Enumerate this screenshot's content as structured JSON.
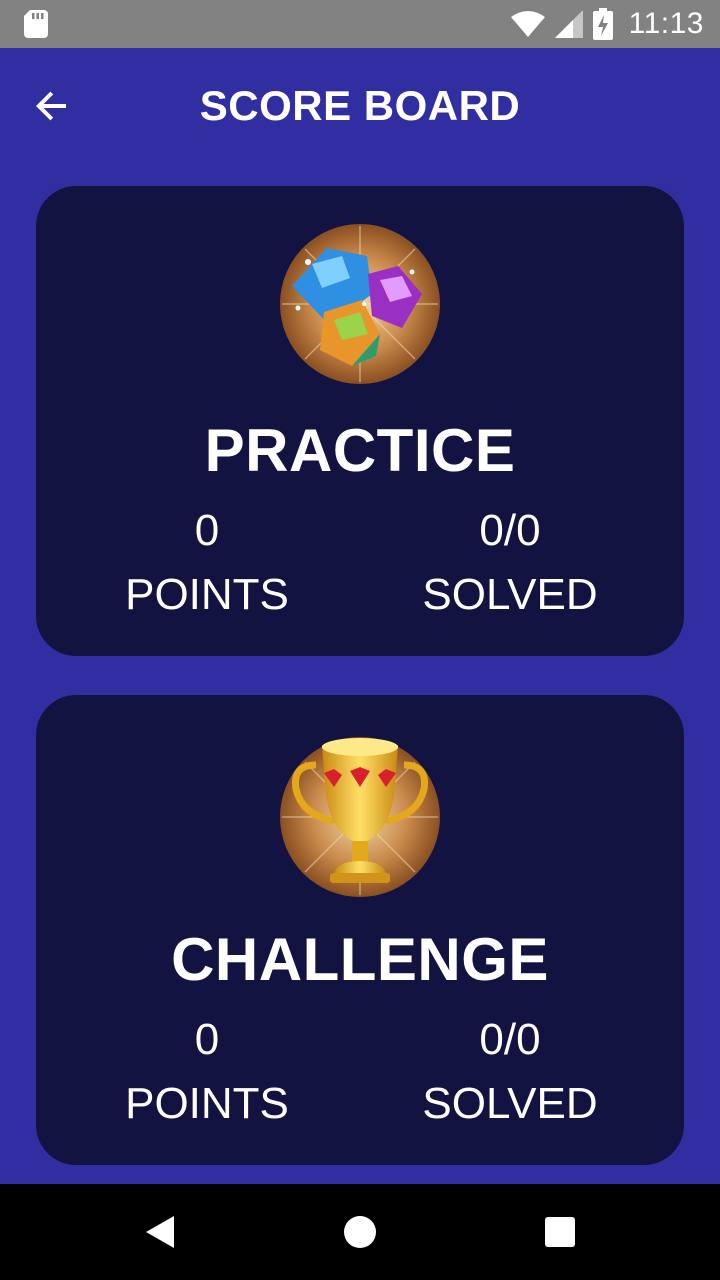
{
  "status_bar": {
    "time": "11:13"
  },
  "app_bar": {
    "title": "SCORE BOARD"
  },
  "cards": [
    {
      "title": "PRACTICE",
      "icon": "gems-icon",
      "points_value": "0",
      "points_label": "POINTS",
      "solved_value": "0/0",
      "solved_label": "SOLVED"
    },
    {
      "title": "CHALLENGE",
      "icon": "trophy-icon",
      "points_value": "0",
      "points_label": "POINTS",
      "solved_value": "0/0",
      "solved_label": "SOLVED"
    }
  ],
  "colors": {
    "background": "#312ea1",
    "card": "#131341",
    "status_bar": "#828282",
    "nav_bar": "#000000"
  }
}
